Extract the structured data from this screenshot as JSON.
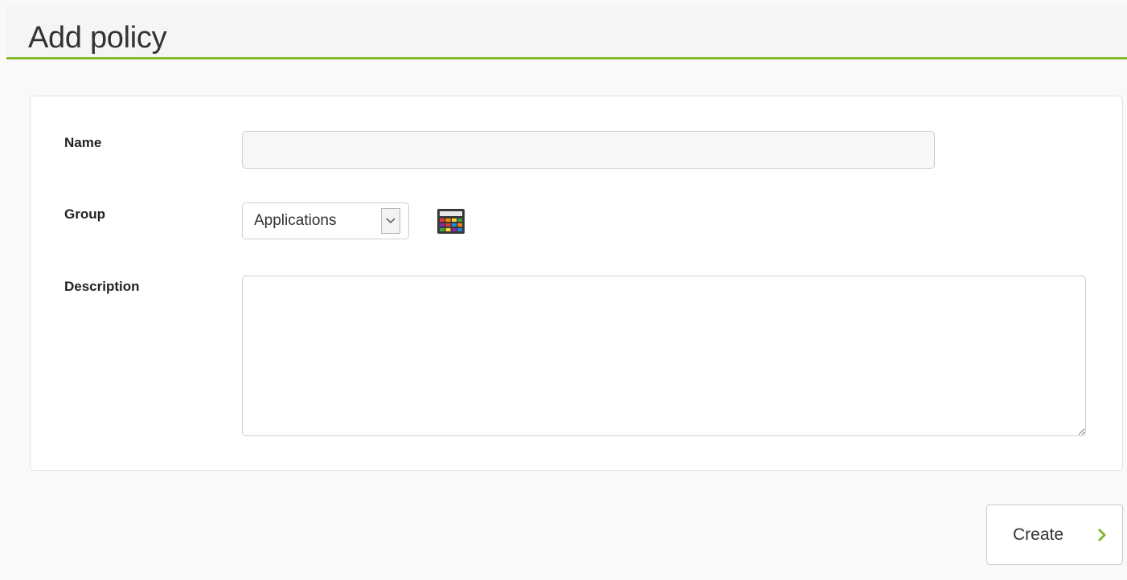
{
  "header": {
    "title": "Add policy"
  },
  "form": {
    "name_label": "Name",
    "name_value": "",
    "group_label": "Group",
    "group_selected": "Applications",
    "description_label": "Description",
    "description_value": ""
  },
  "actions": {
    "create_label": "Create"
  },
  "colors": {
    "accent": "#82b92e"
  },
  "icons": [
    "chevron-down-icon",
    "calculator-icon",
    "chevron-right-icon"
  ]
}
